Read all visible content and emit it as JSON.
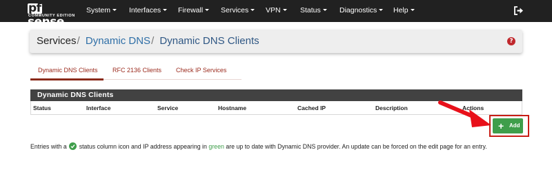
{
  "brand": {
    "logo_pf": "pf",
    "logo_text": "sense",
    "edition": "COMMUNITY EDITION"
  },
  "nav": {
    "system": "System",
    "interfaces": "Interfaces",
    "firewall": "Firewall",
    "services": "Services",
    "vpn": "VPN",
    "status": "Status",
    "diagnostics": "Diagnostics",
    "help": "Help"
  },
  "breadcrumb": {
    "level1": "Services",
    "separator": "/",
    "level2": "Dynamic DNS",
    "level3": "Dynamic DNS Clients"
  },
  "help_icon": {
    "glyph": "?"
  },
  "tabs": [
    {
      "label": "Dynamic DNS Clients",
      "active": true
    },
    {
      "label": "RFC 2136 Clients",
      "active": false
    },
    {
      "label": "Check IP Services",
      "active": false
    }
  ],
  "table": {
    "title": "Dynamic DNS Clients",
    "columns": [
      "Status",
      "Interface",
      "Service",
      "Hostname",
      "Cached IP",
      "Description",
      "Actions"
    ],
    "rows": []
  },
  "add_button": {
    "plus": "+",
    "label": "Add"
  },
  "note": {
    "part1": "Entries with a",
    "part2": "status column icon and IP address appearing in",
    "green_word": "green",
    "part3": "are up to date with Dynamic DNS provider. An update can be forced on the edit page for an entry."
  },
  "colors": {
    "navbar": "#212121",
    "tab_text": "#9b2b1e",
    "table_header": "#424242",
    "add_button": "#3f9e4b",
    "highlight": "#c81d15",
    "breadcrumb_link": "#2f6fa7"
  }
}
